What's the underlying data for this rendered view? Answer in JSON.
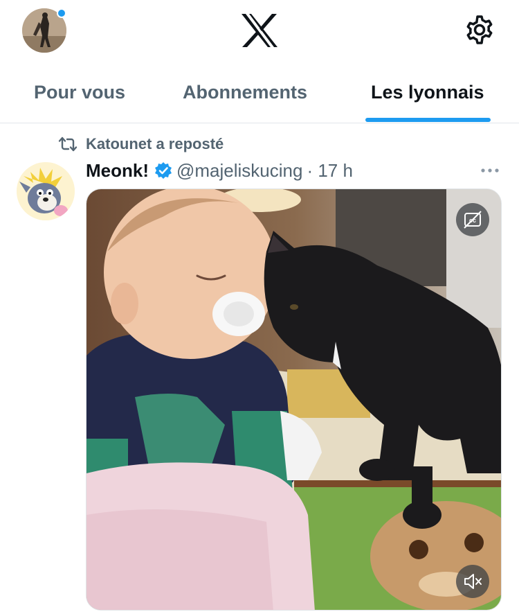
{
  "header": {
    "avatar_icon": "user-avatar-icon",
    "logo_icon": "x-logo-icon",
    "settings_icon": "gear-icon",
    "notification_dot_color": "#1d9bf0"
  },
  "tabs": [
    {
      "label": "Pour vous",
      "active": false
    },
    {
      "label": "Abonnements",
      "active": false
    },
    {
      "label": "Les lyonnais",
      "active": true
    }
  ],
  "accent_color": "#1d9bf0",
  "post": {
    "repost_text": "Katounet a reposté",
    "display_name": "Meonk!",
    "verified": true,
    "handle": "@majeliskucing",
    "time": "· 17 h",
    "media": {
      "type": "video",
      "cc_icon": "closed-captions-off-icon",
      "mute_icon": "speaker-muted-icon"
    }
  }
}
